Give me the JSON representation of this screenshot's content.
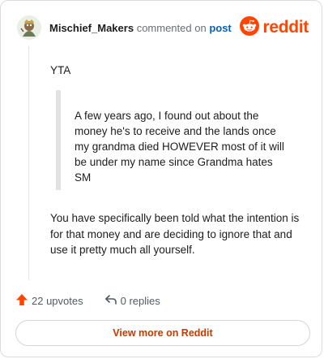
{
  "header": {
    "username": "Mischief_Makers",
    "action_text": "commented on",
    "post_link": "post",
    "brand": "reddit"
  },
  "comment": {
    "verdict": "YTA",
    "quote": "A few years ago, I found out about the money he's to receive and the lands once my grandma died HOWEVER most of it will be under my name since Grandma hates SM",
    "body": "You have specifically been told what the intention is for that money and are deciding to ignore that and use it pretty much all yourself."
  },
  "footer": {
    "upvotes": "22 upvotes",
    "replies": "0 replies",
    "view_more": "View more on Reddit"
  },
  "colors": {
    "brand": "#ff4500",
    "link": "#0a5fb8",
    "button_text": "#c43a00"
  },
  "icons": {
    "upvote": "upvote-arrow-icon",
    "reply": "reply-arrow-icon",
    "logo": "reddit-snoo-icon"
  }
}
